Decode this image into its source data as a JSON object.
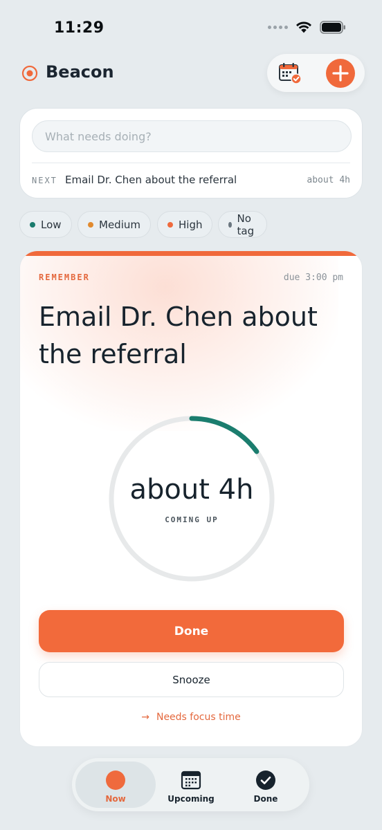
{
  "status_bar": {
    "time": "11:29"
  },
  "header": {
    "app_name": "Beacon"
  },
  "composer": {
    "placeholder": "What needs doing?",
    "next_label": "NEXT",
    "next_title": "Email Dr. Chen about the referral",
    "next_eta": "about 4h"
  },
  "tags": [
    {
      "label": "Low",
      "color": "#1a7b6d"
    },
    {
      "label": "Medium",
      "color": "#e18a2e"
    },
    {
      "label": "High",
      "color": "#ef6a3d"
    },
    {
      "label": "No tag",
      "color": "#6b7780"
    }
  ],
  "focus_card": {
    "kicker": "REMEMBER",
    "due": "due 3:00 pm",
    "title": "Email Dr. Chen about the referral",
    "ring_value": "about 4h",
    "ring_caption": "COMING UP",
    "ring_progress": 0.15,
    "ring_color": "#1b7d6e",
    "done_label": "Done",
    "snooze_label": "Snooze",
    "hint": "Needs focus time"
  },
  "tabbar": {
    "items": [
      {
        "label": "Now",
        "active": true
      },
      {
        "label": "Upcoming",
        "active": false
      },
      {
        "label": "Done",
        "active": false
      }
    ]
  },
  "colors": {
    "accent": "#f0693b",
    "teal": "#1b7d6e",
    "background": "#e6ebee"
  }
}
